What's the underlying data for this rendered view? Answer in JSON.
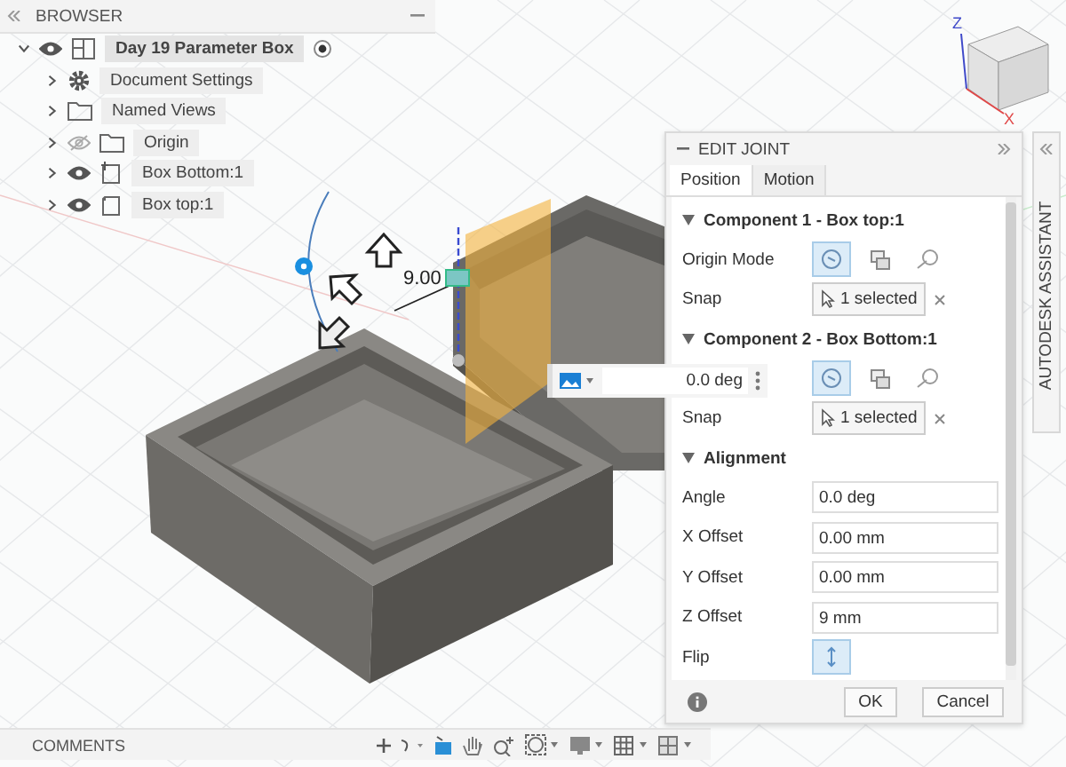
{
  "browser": {
    "title": "BROWSER",
    "items": [
      {
        "label": "Day 19 Parameter Box",
        "kind": "component",
        "expanded": true,
        "visible": true,
        "active": true,
        "selected": true
      },
      {
        "label": "Document Settings",
        "kind": "settings",
        "expanded": false,
        "selected": false
      },
      {
        "label": "Named Views",
        "kind": "folder",
        "expanded": false,
        "selected": false
      },
      {
        "label": "Origin",
        "kind": "folder",
        "expanded": false,
        "visible": false,
        "selected": false
      },
      {
        "label": "Box Bottom:1",
        "kind": "body-linked",
        "expanded": false,
        "visible": true,
        "selected": false
      },
      {
        "label": "Box top:1",
        "kind": "body",
        "expanded": false,
        "visible": true,
        "selected": false
      }
    ]
  },
  "viewport": {
    "dimension": "9.00",
    "floating_input": {
      "value": "0.0 deg"
    },
    "axes": [
      "Z",
      "X"
    ]
  },
  "edit_joint": {
    "title": "EDIT JOINT",
    "tabs": [
      {
        "label": "Position",
        "selected": true
      },
      {
        "label": "Motion",
        "selected": false
      }
    ],
    "sections": [
      {
        "title": "Component 1 - Box top:1",
        "expanded": true,
        "rows": [
          {
            "kind": "modes",
            "label": "Origin Mode",
            "modes": [
              {
                "selected": true
              },
              {
                "selected": false
              },
              {
                "selected": false
              }
            ]
          },
          {
            "kind": "select",
            "label": "Snap",
            "value": "1 selected"
          }
        ]
      },
      {
        "title": "Component 2 - Box Bottom:1",
        "expanded": true,
        "rows": [
          {
            "kind": "modes",
            "modes": [
              {
                "selected": true
              },
              {
                "selected": false
              },
              {
                "selected": false
              }
            ]
          },
          {
            "kind": "select",
            "label": "Snap",
            "value": "1 selected"
          }
        ]
      },
      {
        "title": "Alignment",
        "expanded": true,
        "rows": [
          {
            "kind": "field",
            "label": "Angle",
            "value": "0.0 deg"
          },
          {
            "kind": "field",
            "label": "X Offset",
            "value": "0.00 mm"
          },
          {
            "kind": "field",
            "label": "Y Offset",
            "value": "0.00 mm"
          },
          {
            "kind": "field",
            "label": "Z Offset",
            "value": "9 mm"
          },
          {
            "kind": "toggle",
            "label": "Flip",
            "on": true
          }
        ]
      }
    ],
    "buttons": [
      "OK",
      "Cancel"
    ]
  },
  "assistant": {
    "label": "AUTODESK ASSISTANT"
  },
  "comments": {
    "title": "COMMENTS"
  }
}
